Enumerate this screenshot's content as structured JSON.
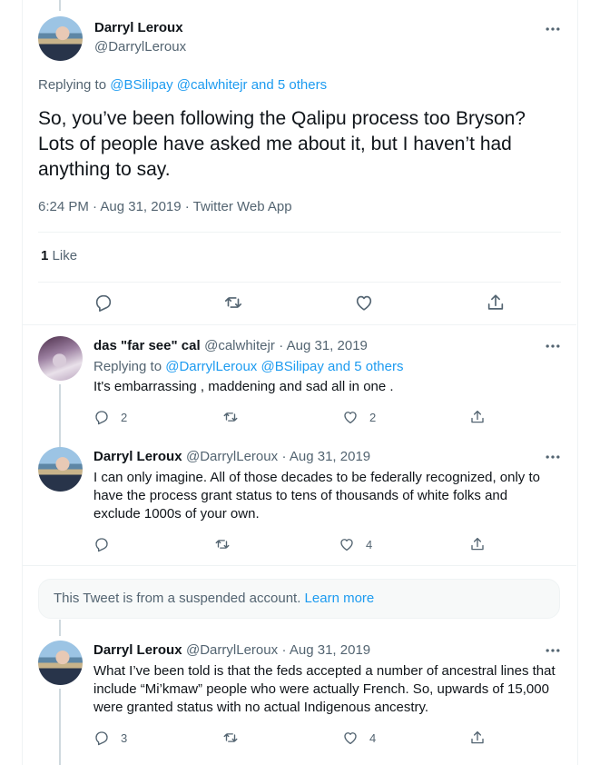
{
  "main_tweet": {
    "author_name": "Darryl Leroux",
    "author_handle": "@DarrylLeroux",
    "replying_prefix": "Replying to",
    "replying_to": "@BSilipay @calwhitejr and 5 others",
    "text": "So, you’ve been following the Qalipu process too Bryson? Lots of people have asked me about it, but I haven’t had anything to say.",
    "time": "6:24 PM · Aug 31, 2019 · Twitter Web App",
    "likes_count": "1",
    "likes_label": "Like"
  },
  "replies": [
    {
      "author_name": "das \"far see\" cal",
      "author_handle": "@calwhitejr",
      "date": "· Aug 31, 2019",
      "replying_prefix": "Replying to",
      "replying_to": "@DarrylLeroux @BSilipay and 5 others",
      "text": "It's embarrassing , maddening and sad all in one .",
      "reply_count": "2",
      "retweet_count": "",
      "like_count": "2"
    },
    {
      "author_name": "Darryl Leroux",
      "author_handle": "@DarrylLeroux",
      "date": "· Aug 31, 2019",
      "text": "I can only imagine. All of those decades to be federally recognized, only to have the process grant status to tens of thousands of white folks and exclude 1000s of your own.",
      "reply_count": "",
      "retweet_count": "",
      "like_count": "4"
    },
    {
      "author_name": "Darryl Leroux",
      "author_handle": "@DarrylLeroux",
      "date": "· Aug 31, 2019",
      "text": "What I’ve been told is that the feds accepted a number of ancestral lines that include “Mi’kmaw” people who were actually French. So, upwards of 15,000 were granted status with no actual Indigenous ancestry.",
      "reply_count": "3",
      "retweet_count": "",
      "like_count": "4"
    }
  ],
  "suspended_notice": {
    "text": "This Tweet is from a suspended account.",
    "link": "Learn more"
  },
  "icons": {
    "reply": "reply-icon",
    "retweet": "retweet-icon",
    "like": "heart-icon",
    "share": "share-icon",
    "more": "more-icon"
  },
  "colors": {
    "link": "#1d9bf0",
    "muted": "#536471",
    "text": "#0f1419"
  }
}
